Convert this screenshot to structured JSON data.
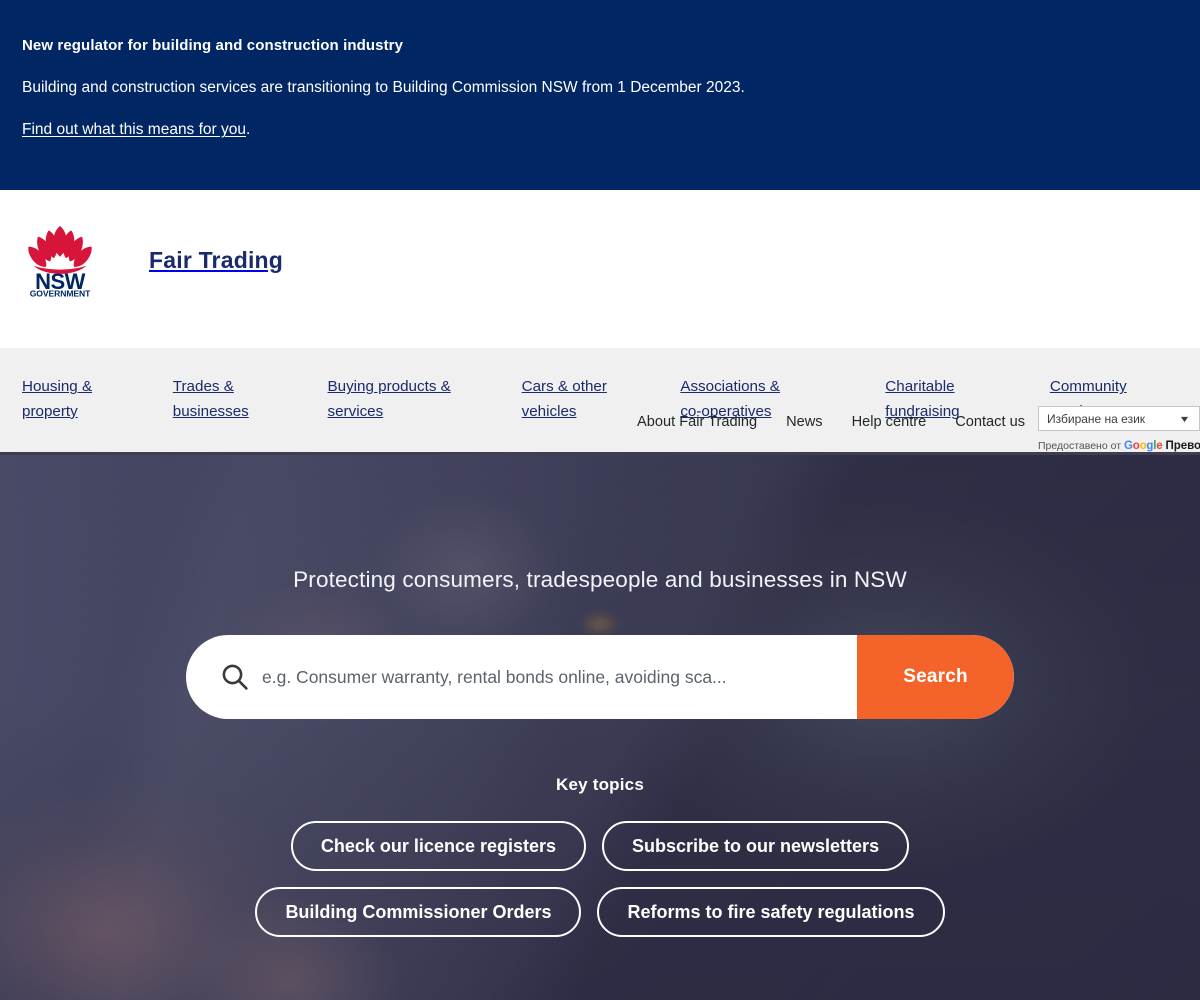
{
  "alert": {
    "title": "New regulator for building and construction industry",
    "body": "Building and construction services are transitioning to Building Commission NSW from 1 December 2023.",
    "link_text": "Find out what this means for you",
    "link_suffix": ".",
    "background_color": "#002664"
  },
  "header": {
    "logo_alt": "NSW Government",
    "logo_line1": "NSW",
    "logo_line2": "GOVERNMENT",
    "brand_title": "Fair Trading",
    "utility_links": [
      {
        "label": "About Fair Trading"
      },
      {
        "label": "News"
      },
      {
        "label": "Help centre"
      },
      {
        "label": "Contact us"
      }
    ],
    "translate": {
      "selected": "Избиране на език",
      "credit_prefix": "Предоставено от",
      "credit_brand": "Google",
      "credit_suffix": "Превод"
    }
  },
  "main_nav": {
    "items": [
      {
        "label": "Housing &\nproperty"
      },
      {
        "label": "Trades &\nbusinesses"
      },
      {
        "label": "Buying products &\nservices"
      },
      {
        "label": "Cars & other\nvehicles"
      },
      {
        "label": "Associations &\nco-operatives"
      },
      {
        "label": "Charitable\nfundraising"
      },
      {
        "label": "Community\ngaming"
      }
    ],
    "background_color": "#f0f0f0",
    "text_color": "#1b2a6b"
  },
  "hero": {
    "tagline": "Protecting consumers, tradespeople and businesses in NSW",
    "search": {
      "placeholder": "e.g. Consumer warranty, rental bonds online, avoiding sca...",
      "value": "",
      "button_label": "Search",
      "button_color": "#f4642a"
    },
    "key_topics": {
      "heading": "Key topics",
      "rows": [
        [
          {
            "label": "Check our licence registers"
          },
          {
            "label": "Subscribe to our newsletters"
          }
        ],
        [
          {
            "label": "Building Commissioner Orders"
          },
          {
            "label": "Reforms to fire safety regulations"
          }
        ]
      ]
    }
  },
  "colors": {
    "nsw_navy": "#002664",
    "nsw_red": "#d7153a",
    "accent_orange": "#f4642a",
    "brand_text": "#1b2a6b"
  }
}
